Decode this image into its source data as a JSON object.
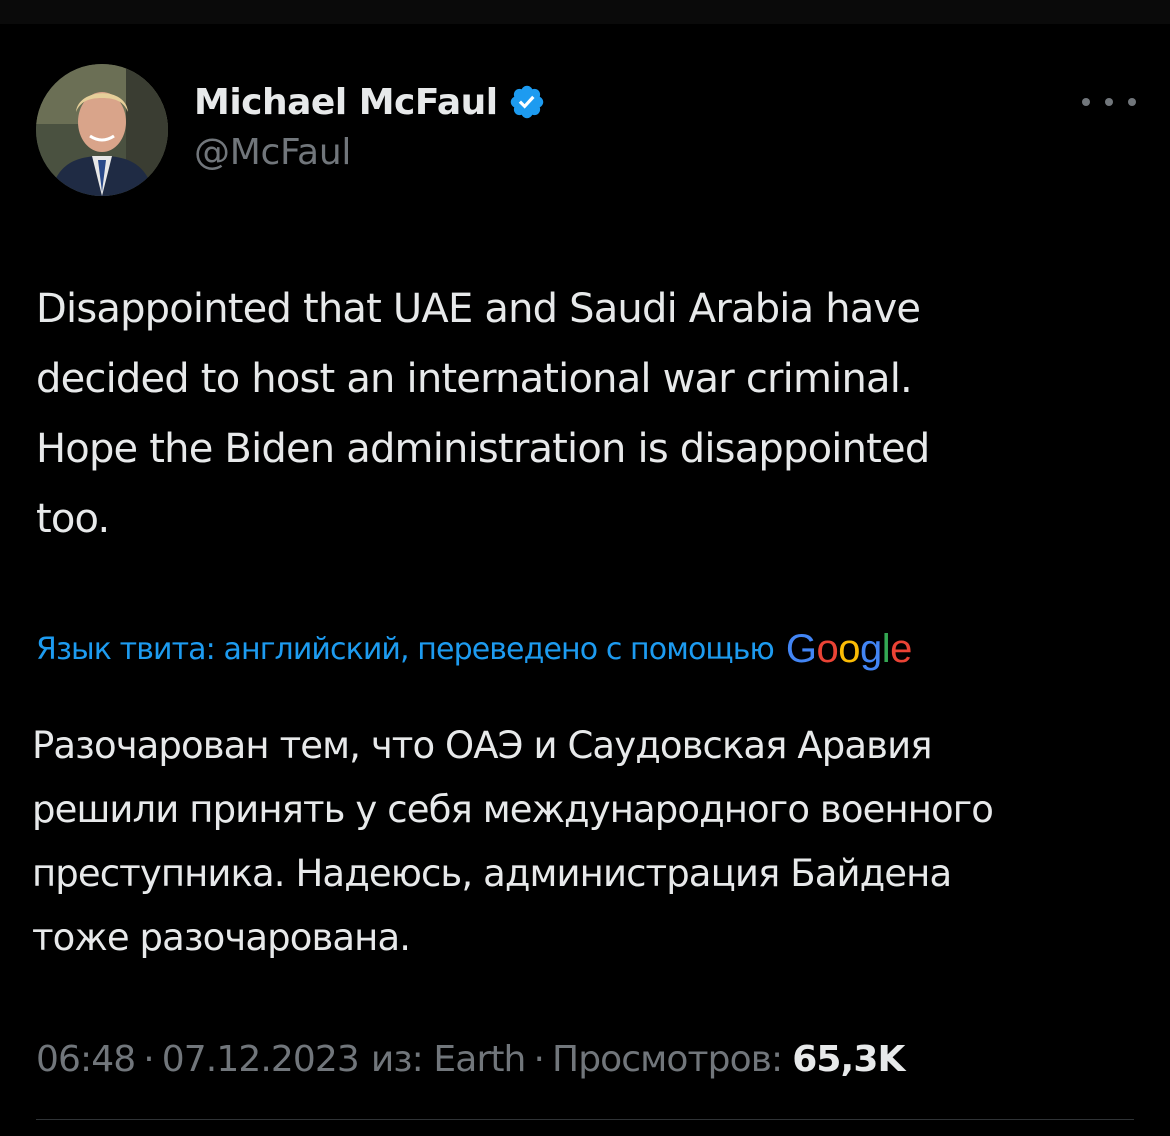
{
  "author": {
    "display_name": "Michael McFaul",
    "handle": "@McFaul",
    "verified": true
  },
  "colors": {
    "background": "#000000",
    "text": "#e7e9ea",
    "secondary": "#71767b",
    "accent": "#1d9bf0",
    "verified": "#1d9bf0"
  },
  "icons": {
    "verified": "verified-badge-icon",
    "more": "more-horizontal-icon"
  },
  "tweet": {
    "text": "Disappointed that UAE and Saudi Arabia have\ndecided to host an international war criminal.\nHope the Biden administration is disappointed\ntoo."
  },
  "translation": {
    "label": "Язык твита: английский, переведено с помощью",
    "provider": "Google",
    "text": "Разочарован тем, что ОАЭ и Саудовская Аравия\nрешили принять у себя международного военного\nпреступника. Надеюсь, администрация Байдена\nтоже разочарована."
  },
  "meta": {
    "time": "06:48",
    "separator": "·",
    "date": "07.12.2023",
    "source": "из: Earth",
    "views_label": "Просмотров:",
    "views_count": "65,3K"
  }
}
